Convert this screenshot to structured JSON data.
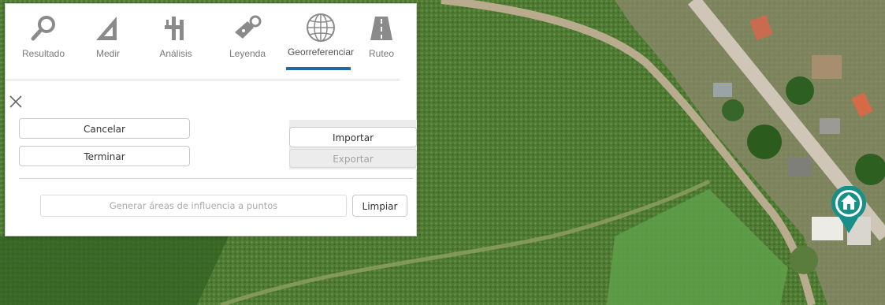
{
  "toolbar": {
    "tabs": [
      {
        "label": "Resultado",
        "icon": "magnifier-icon"
      },
      {
        "label": "Medir",
        "icon": "ruler-triangle-icon"
      },
      {
        "label": "Análisis",
        "icon": "analysis-icon"
      },
      {
        "label": "Leyenda",
        "icon": "tag-icon"
      },
      {
        "label": "Georreferenciar",
        "icon": "globe-icon"
      },
      {
        "label": "Ruteo",
        "icon": "road-icon"
      }
    ],
    "active_tab": "Georreferenciar"
  },
  "panel": {
    "cancel_label": "Cancelar",
    "finish_label": "Terminar",
    "import_label": "Importar",
    "export_label": "Exportar",
    "buffer_placeholder": "Generar áreas de influencia a puntos",
    "clear_label": "Limpiar"
  },
  "map": {
    "marker_icon": "home-icon",
    "colors": {
      "field": "#4d7a2f",
      "road": "#c9bca4",
      "marker": "#17908a",
      "accent": "#1f6aa5"
    }
  }
}
